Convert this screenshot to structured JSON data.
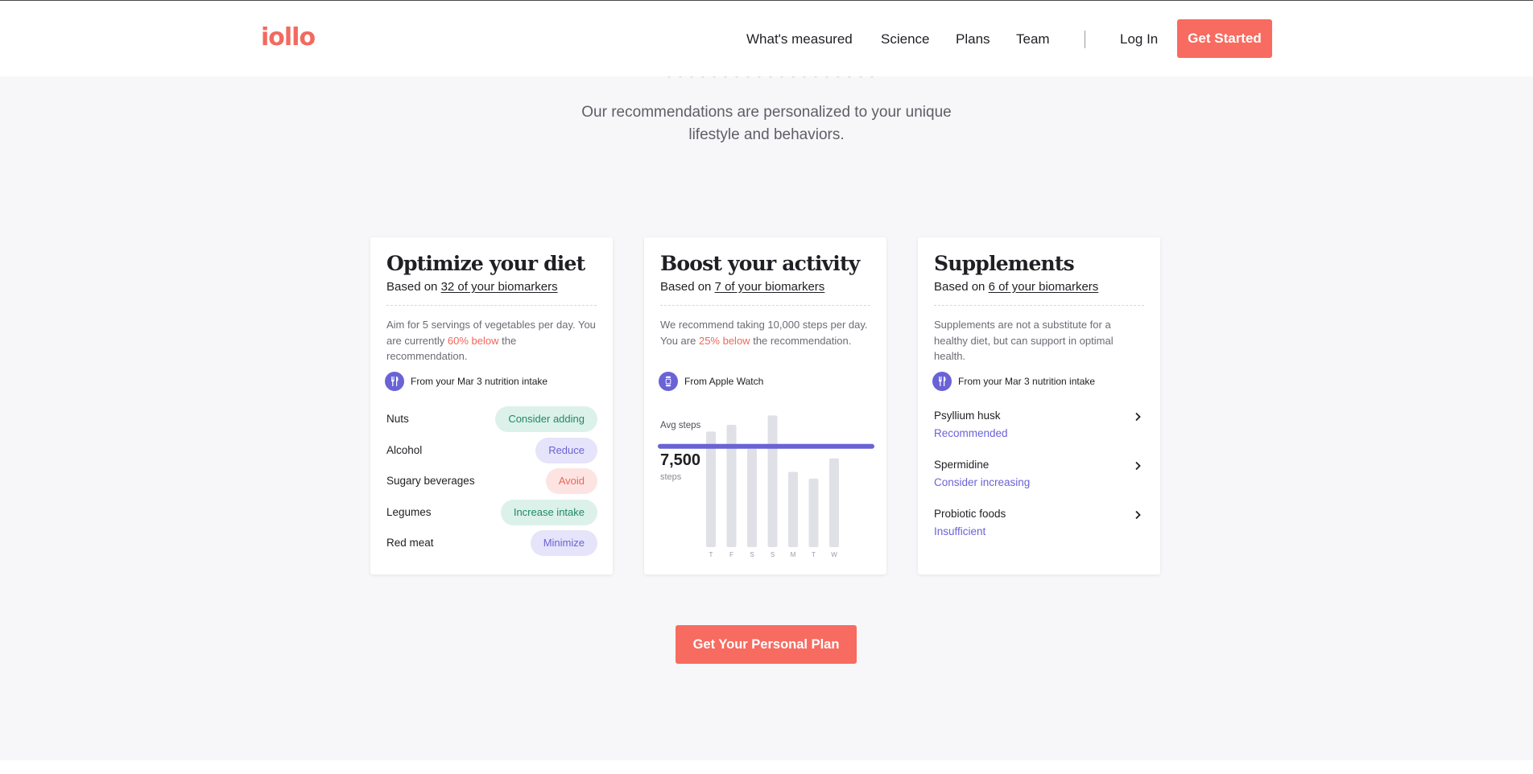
{
  "brand": {
    "logo_text": "iollo",
    "accent_color": "#f76b60",
    "secondary_color": "#6a63d6"
  },
  "nav": {
    "links": [
      "What's measured",
      "Science",
      "Plans",
      "Team"
    ],
    "login_label": "Log In",
    "get_started_label": "Get Started"
  },
  "hero": {
    "subtitle_line1": "Our recommendations are personalized to your unique",
    "subtitle_line2": "lifestyle and behaviors."
  },
  "cards": {
    "diet": {
      "title": "Optimize your diet",
      "based_prefix": "Based on",
      "based_link": "32 of your biomarkers",
      "desc_before": "Aim for 5 servings of vegetables per day. You are currently",
      "desc_highlight": "60% below",
      "desc_after": "the recommendation.",
      "source_icon": "utensils-icon",
      "source_text": "From your Mar 3 nutrition intake",
      "items": [
        {
          "label": "Nuts",
          "action": "Consider adding",
          "tone": "green"
        },
        {
          "label": "Alcohol",
          "action": "Reduce",
          "tone": "purple"
        },
        {
          "label": "Sugary beverages",
          "action": "Avoid",
          "tone": "red"
        },
        {
          "label": "Legumes",
          "action": "Increase intake",
          "tone": "green"
        },
        {
          "label": "Red meat",
          "action": "Minimize",
          "tone": "purple"
        }
      ]
    },
    "activity": {
      "title": "Boost your activity",
      "based_prefix": "Based on",
      "based_link": "7 of your biomarkers",
      "desc_before": "We recommend taking 10,000 steps per day. You are",
      "desc_highlight": "25% below",
      "desc_after": "the recommendation.",
      "source_icon": "watch-icon",
      "source_text": "From Apple Watch",
      "avg_label": "Avg steps",
      "avg_value": "7,500",
      "avg_unit": "steps"
    },
    "supplements": {
      "title": "Supplements",
      "based_prefix": "Based on",
      "based_link": "6 of your biomarkers",
      "desc_before": "Supplements are not a substitute for a healthy diet, but can support in optimal health.",
      "source_icon": "utensils-icon",
      "source_text": "From your Mar 3 nutrition intake",
      "items": [
        {
          "name": "Psyllium husk",
          "status": "Recommended"
        },
        {
          "name": "Spermidine",
          "status": "Consider increasing"
        },
        {
          "name": "Probiotic foods",
          "status": "Insufficient"
        }
      ]
    }
  },
  "chart_data": {
    "type": "bar",
    "categories": [
      "T",
      "F",
      "S",
      "S",
      "M",
      "T",
      "W"
    ],
    "values": [
      8600,
      9100,
      7300,
      9800,
      5600,
      5100,
      6600
    ],
    "average": 7500,
    "ylim": [
      0,
      10000
    ],
    "bar_color": "#e0e0e7",
    "average_line_color": "#6a63d6"
  },
  "cta": {
    "label": "Get Your Personal Plan"
  }
}
